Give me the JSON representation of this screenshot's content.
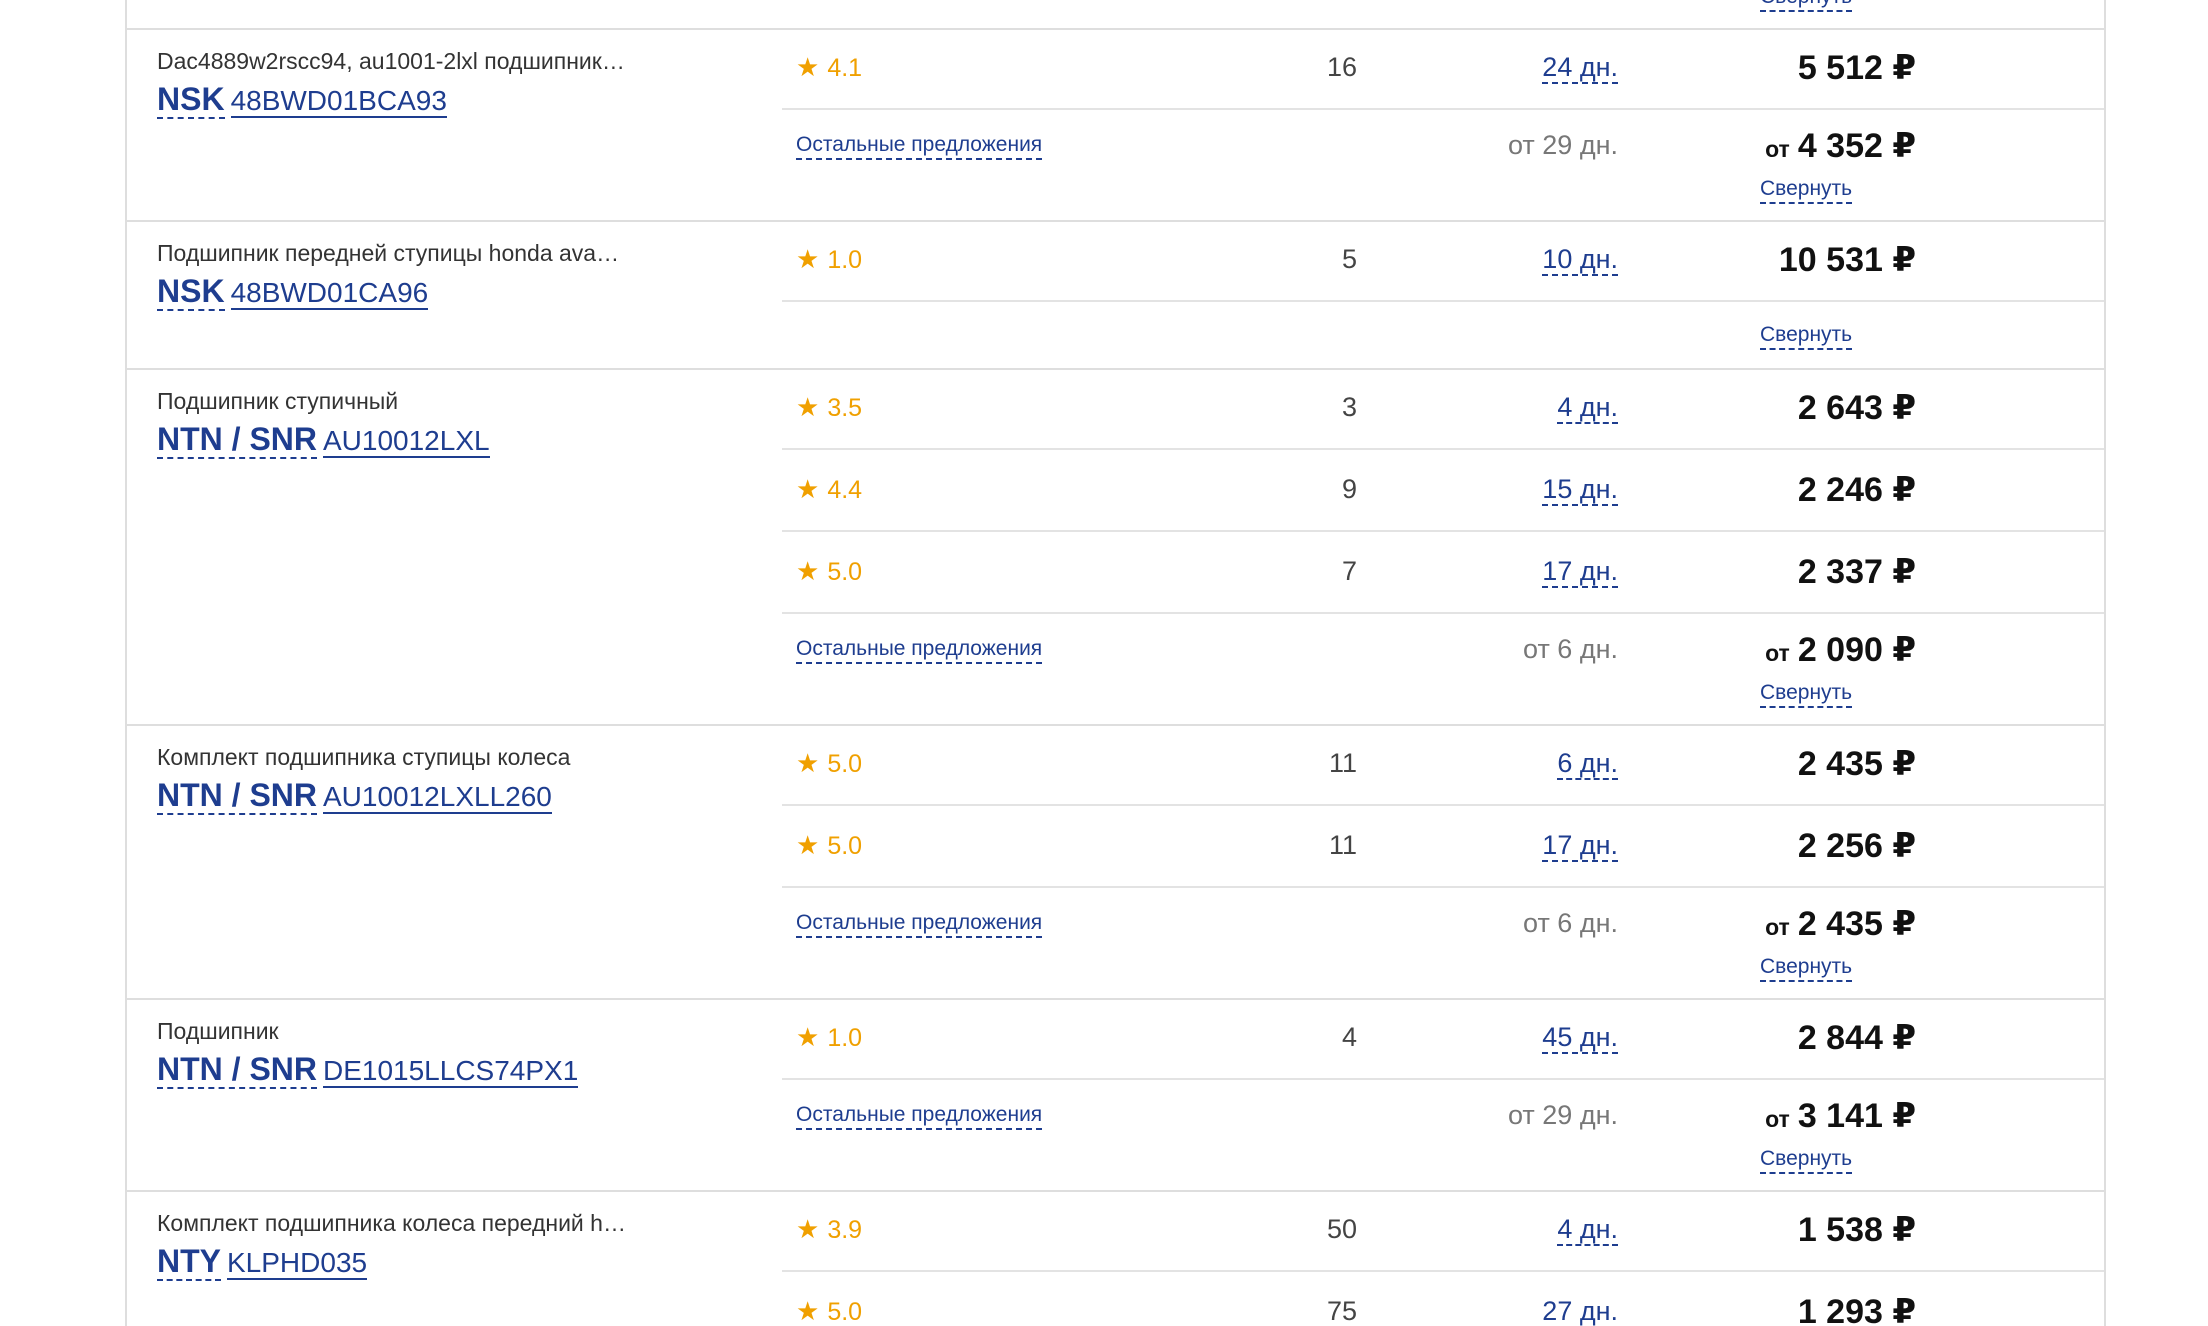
{
  "currency": "₽",
  "collapse_label": "Свернуть",
  "other_offers_label": "Остальные предложения",
  "from_label": "от",
  "products": [
    {
      "description": "Dac4889w2rscc94, au1001-2lxl подшипник…",
      "brand": "NSK",
      "article": "48BWD01BCA93",
      "offers": [
        {
          "rating": "4.1",
          "qty": "16",
          "days": "24 дн.",
          "price": "5 512 ₽"
        }
      ],
      "other": {
        "days": "от 29 дн.",
        "price": "4 352 ₽"
      }
    },
    {
      "description": "Подшипник передней ступицы honda ava…",
      "brand": "NSK",
      "article": "48BWD01CA96",
      "offers": [
        {
          "rating": "1.0",
          "qty": "5",
          "days": "10 дн.",
          "price": "10 531 ₽"
        }
      ]
    },
    {
      "description": "Подшипник ступичный",
      "brand": "NTN / SNR",
      "article": "AU10012LXL",
      "offers": [
        {
          "rating": "3.5",
          "qty": "3",
          "days": "4 дн.",
          "price": "2 643 ₽"
        },
        {
          "rating": "4.4",
          "qty": "9",
          "days": "15 дн.",
          "price": "2 246 ₽"
        },
        {
          "rating": "5.0",
          "qty": "7",
          "days": "17 дн.",
          "price": "2 337 ₽"
        }
      ],
      "other": {
        "days": "от 6 дн.",
        "price": "2 090 ₽"
      }
    },
    {
      "description": "Комплект подшипника ступицы колеса",
      "brand": "NTN / SNR",
      "article": "AU10012LXLL260",
      "offers": [
        {
          "rating": "5.0",
          "qty": "11",
          "days": "6 дн.",
          "price": "2 435 ₽"
        },
        {
          "rating": "5.0",
          "qty": "11",
          "days": "17 дн.",
          "price": "2 256 ₽"
        }
      ],
      "other": {
        "days": "от 6 дн.",
        "price": "2 435 ₽"
      }
    },
    {
      "description": "Подшипник",
      "brand": "NTN / SNR",
      "article": "DE1015LLCS74PX1",
      "offers": [
        {
          "rating": "1.0",
          "qty": "4",
          "days": "45 дн.",
          "price": "2 844 ₽"
        }
      ],
      "other": {
        "days": "от 29 дн.",
        "price": "3 141 ₽"
      }
    },
    {
      "description": "Комплект подшипника колеса передний h…",
      "brand": "NTY",
      "article": "KLPHD035",
      "offers": [
        {
          "rating": "3.9",
          "qty": "50",
          "days": "4 дн.",
          "price": "1 538 ₽"
        },
        {
          "rating": "5.0",
          "qty": "75",
          "days": "27 дн.",
          "price": "1 293 ₽"
        }
      ]
    }
  ]
}
